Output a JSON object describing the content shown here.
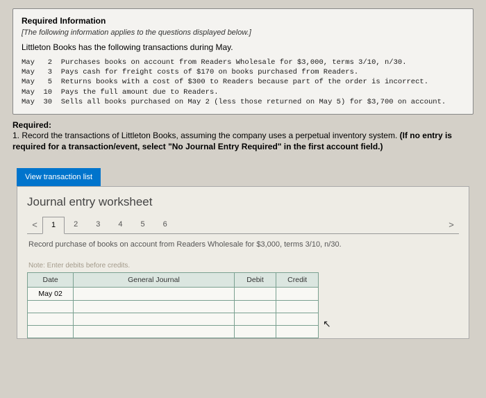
{
  "info": {
    "header": "Required Information",
    "sub": "[The following information applies to the questions displayed below.]",
    "desc": "Littleton Books has the following transactions during May.",
    "lines": [
      "May   2  Purchases books on account from Readers Wholesale for $3,000, terms 3/10, n/30.",
      "May   3  Pays cash for freight costs of $170 on books purchased from Readers.",
      "May   5  Returns books with a cost of $300 to Readers because part of the order is incorrect.",
      "May  10  Pays the full amount due to Readers.",
      "May  30  Sells all books purchased on May 2 (less those returned on May 5) for $3,700 on account."
    ]
  },
  "required": {
    "heading": "Required:",
    "text1": "1. Record the transactions of Littleton Books, assuming the company uses a perpetual inventory system. ",
    "bold": "(If no entry is required for a transaction/event, select \"No Journal Entry Required\" in the first account field.)"
  },
  "viewBtn": "View transaction list",
  "worksheet": {
    "title": "Journal entry worksheet",
    "tabs": [
      "1",
      "2",
      "3",
      "4",
      "5",
      "6"
    ],
    "instruction": "Record purchase of books on account from Readers Wholesale for $3,000, terms 3/10, n/30.",
    "note": "Note: Enter debits before credits.",
    "headers": {
      "date": "Date",
      "gj": "General Journal",
      "debit": "Debit",
      "credit": "Credit"
    },
    "rows": [
      {
        "date": "May 02",
        "gj": "",
        "debit": "",
        "credit": ""
      },
      {
        "date": "",
        "gj": "",
        "debit": "",
        "credit": ""
      },
      {
        "date": "",
        "gj": "",
        "debit": "",
        "credit": ""
      },
      {
        "date": "",
        "gj": "",
        "debit": "",
        "credit": ""
      }
    ],
    "nav": {
      "prev": "<",
      "next": ">"
    }
  }
}
